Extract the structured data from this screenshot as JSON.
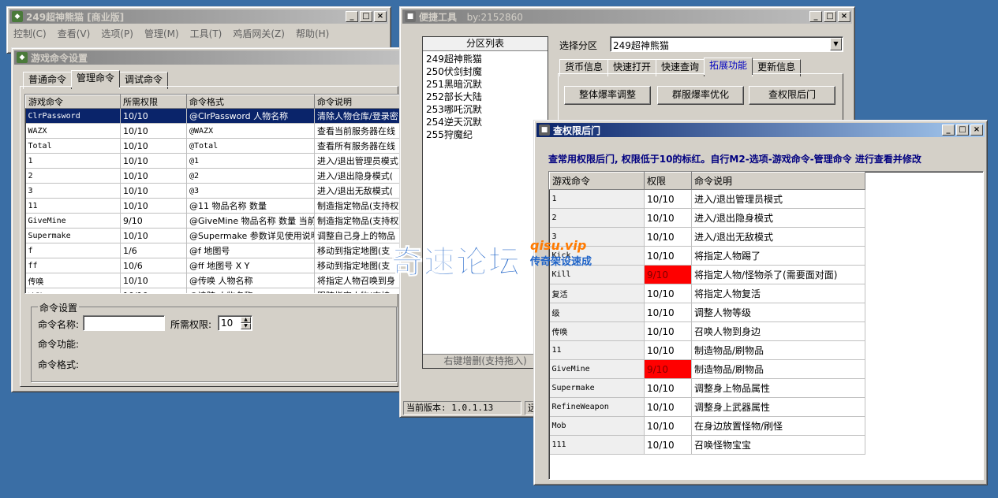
{
  "main_window": {
    "title": "249超神熊猫 [商业版]",
    "menu": [
      "控制(C)",
      "查看(V)",
      "选项(P)",
      "管理(M)",
      "工具(T)",
      "鸡盾网关(Z)",
      "帮助(H)"
    ]
  },
  "game_cmd_window": {
    "title": "游戏命令设置",
    "tabs": [
      "普通命令",
      "管理命令",
      "调试命令"
    ],
    "columns": [
      "游戏命令",
      "所需权限",
      "命令格式",
      "命令说明"
    ],
    "rows": [
      [
        "ClrPassword",
        "10/10",
        "@ClrPassword 人物名称",
        "清除人物仓库/登录密"
      ],
      [
        "WAZX",
        "10/10",
        "@WAZX",
        "查看当前服务器在线"
      ],
      [
        "Total",
        "10/10",
        "@Total",
        "查看所有服务器在线"
      ],
      [
        "1",
        "10/10",
        "@1",
        "进入/退出管理员模式"
      ],
      [
        "2",
        "10/10",
        "@2",
        "进入/退出隐身模式("
      ],
      [
        "3",
        "10/10",
        "@3",
        "进入/退出无敌模式("
      ],
      [
        "11",
        "10/10",
        "@11 物品名称 数量",
        "制造指定物品(支持权"
      ],
      [
        "GiveMine",
        "9/10",
        "@GiveMine 物品名称 数量 当前",
        "制造指定物品(支持权"
      ],
      [
        "Supermake",
        "10/10",
        "@Supermake 参数详见使用说明",
        "调整自己身上的物品"
      ],
      [
        "f",
        "1/6",
        "@f 地图号",
        "移动到指定地图(支"
      ],
      [
        "ff",
        "10/6",
        "@ff 地图号 X Y",
        "移动到指定地图(支"
      ],
      [
        "传唤",
        "10/10",
        "@传唤 人物名称",
        "将指定人物召唤到身"
      ],
      [
        "追踪",
        "10/10",
        "@追踪 人物名称",
        "跟踪指定人物(支持"
      ]
    ],
    "group": {
      "title": "命令设置",
      "name_label": "命令名称:",
      "perm_label": "所需权限:",
      "perm_value": "10",
      "func_label": "命令功能:",
      "format_label": "命令格式:"
    }
  },
  "tool_window": {
    "title": "便捷工具",
    "by": "by:2152860",
    "list_header": "分区列表",
    "list_items": [
      "249超神熊猫",
      "250伏剑封魔",
      "251黑暗沉默",
      "252部长大陆",
      "253哪吒沉默",
      "254逆天沉默",
      "255狩魔纪"
    ],
    "list_footer": "右键增删(支持拖入)",
    "select_label": "选择分区",
    "select_value": "249超神熊猫",
    "tabs": [
      "货币信息",
      "快速打开",
      "快速查询",
      "拓展功能",
      "更新信息"
    ],
    "buttons": [
      "整体爆率调整",
      "群服爆率优化",
      "查权限后门"
    ],
    "status_version": "当前版本: 1.0.1.13",
    "status_right": "远"
  },
  "perm_window": {
    "title": "查权限后门",
    "notice": "查常用权限后门, 权限低于10的标红。自行M2-选项-游戏命令-管理命令 进行查看并修改",
    "columns": [
      "游戏命令",
      "权限",
      "命令说明"
    ],
    "rows": [
      {
        "cmd": "1",
        "perm": "10/10",
        "desc": "进入/退出管理员模式",
        "red": false
      },
      {
        "cmd": "2",
        "perm": "10/10",
        "desc": "进入/退出隐身模式",
        "red": false
      },
      {
        "cmd": "3",
        "perm": "10/10",
        "desc": "进入/退出无敌模式",
        "red": false
      },
      {
        "cmd": "Kick",
        "perm": "10/10",
        "desc": "将指定人物踢了",
        "red": false
      },
      {
        "cmd": "Kill",
        "perm": "9/10",
        "desc": "将指定人物/怪物杀了(需要面对面)",
        "red": true
      },
      {
        "cmd": "复活",
        "perm": "10/10",
        "desc": "将指定人物复活",
        "red": false
      },
      {
        "cmd": "级",
        "perm": "10/10",
        "desc": "调整人物等级",
        "red": false
      },
      {
        "cmd": "传唤",
        "perm": "10/10",
        "desc": "召唤人物到身边",
        "red": false
      },
      {
        "cmd": "11",
        "perm": "10/10",
        "desc": "制造物品/刷物品",
        "red": false
      },
      {
        "cmd": "GiveMine",
        "perm": "9/10",
        "desc": "制造物品/刷物品",
        "red": true
      },
      {
        "cmd": "Supermake",
        "perm": "10/10",
        "desc": "调整身上物品属性",
        "red": false
      },
      {
        "cmd": "RefineWeapon",
        "perm": "10/10",
        "desc": "调整身上武器属性",
        "red": false
      },
      {
        "cmd": "Mob",
        "perm": "10/10",
        "desc": "在身边放置怪物/刷怪",
        "red": false
      },
      {
        "cmd": "111",
        "perm": "10/10",
        "desc": "召唤怪物宝宝",
        "red": false
      }
    ]
  },
  "watermark": {
    "main": "奇速论坛",
    "domain": "qisu.vip",
    "sub": "传奇架设速成"
  }
}
